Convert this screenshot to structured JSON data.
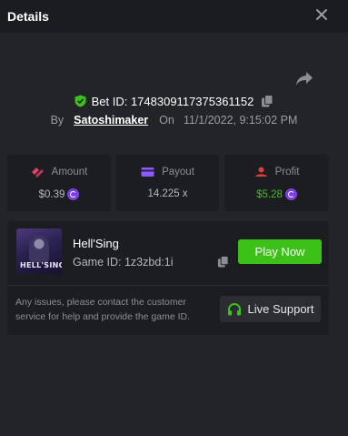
{
  "header": {
    "title": "Details"
  },
  "bet": {
    "id_text": "Bet ID: 1748309117375361152",
    "by_label": "By",
    "username": "Satoshimaker",
    "on_label": "On",
    "datetime": "11/1/2022, 9:15:02 PM"
  },
  "stats": {
    "amount": {
      "label": "Amount",
      "value": "$0.39",
      "color": "#b5b7be"
    },
    "payout": {
      "label": "Payout",
      "value": "14.225 x",
      "color": "#b5b7be"
    },
    "profit": {
      "label": "Profit",
      "value": "$5.28",
      "color": "#3bc117"
    }
  },
  "game": {
    "thumbnail_text": "HELL'SING",
    "name": "Hell'Sing",
    "id_text": "Game ID: 1z3zbd:1i",
    "play_label": "Play Now",
    "support_note": "Any issues, please contact the customer service for help and provide the game ID.",
    "live_support_label": "Live Support"
  },
  "colors": {
    "accent_green": "#3bc117",
    "coin_purple": "#7b3fe4",
    "amount_icon": "#e0406a",
    "payout_icon": "#8a5cf5",
    "profit_icon": "#e03a3a"
  },
  "icons": [
    "close-icon",
    "share-icon",
    "shield-check-icon",
    "copy-icon",
    "amount-icon",
    "payout-icon",
    "profit-icon",
    "coin-icon",
    "headset-icon"
  ]
}
